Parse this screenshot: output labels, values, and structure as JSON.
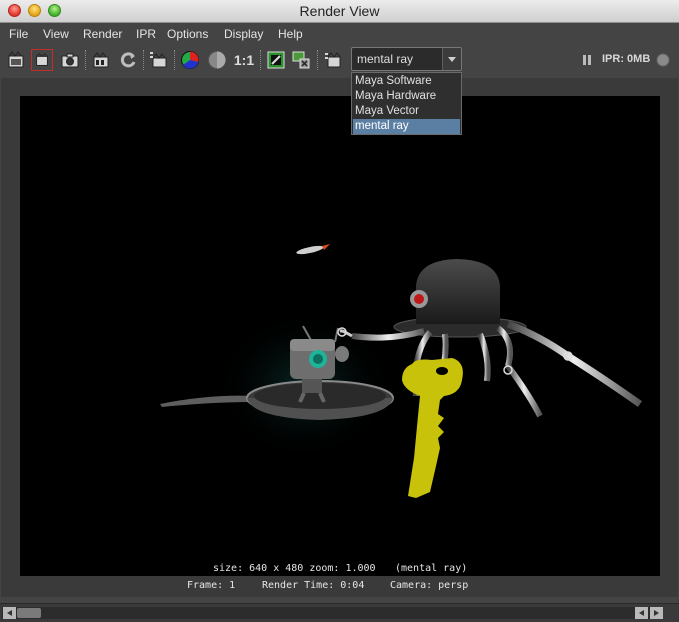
{
  "window": {
    "title": "Render View"
  },
  "menu": [
    "File",
    "View",
    "Render",
    "IPR",
    "Options",
    "Display",
    "Help"
  ],
  "toolbar": {
    "icons": [
      "render-frame-icon",
      "render-region-icon",
      "snapshot-icon",
      "ipr-render-icon",
      "refresh-icon",
      "render-sequence-icon",
      "rgb-channels-icon",
      "alpha-channel-icon",
      "real-size-icon",
      "display-icon",
      "remove-image-icon",
      "render-settings-icon"
    ],
    "real_size_label": "1:1",
    "renderer_value": "mental ray",
    "ipr_label": "IPR: 0MB"
  },
  "renderer_dropdown": {
    "options": [
      "Maya Software",
      "Maya Hardware",
      "Maya Vector",
      "mental ray"
    ],
    "selected": "mental ray"
  },
  "render": {
    "info_size": "size: 640 x 480 zoom: 1.000",
    "info_renderer": "(mental ray)",
    "frame": "Frame: 1",
    "render_time": "Render Time: 0:04",
    "camera": "Camera: persp"
  },
  "colors": {
    "selection": "#5b7ea3",
    "key": "#c9c20a",
    "bot_eye": "#1fb39a"
  }
}
